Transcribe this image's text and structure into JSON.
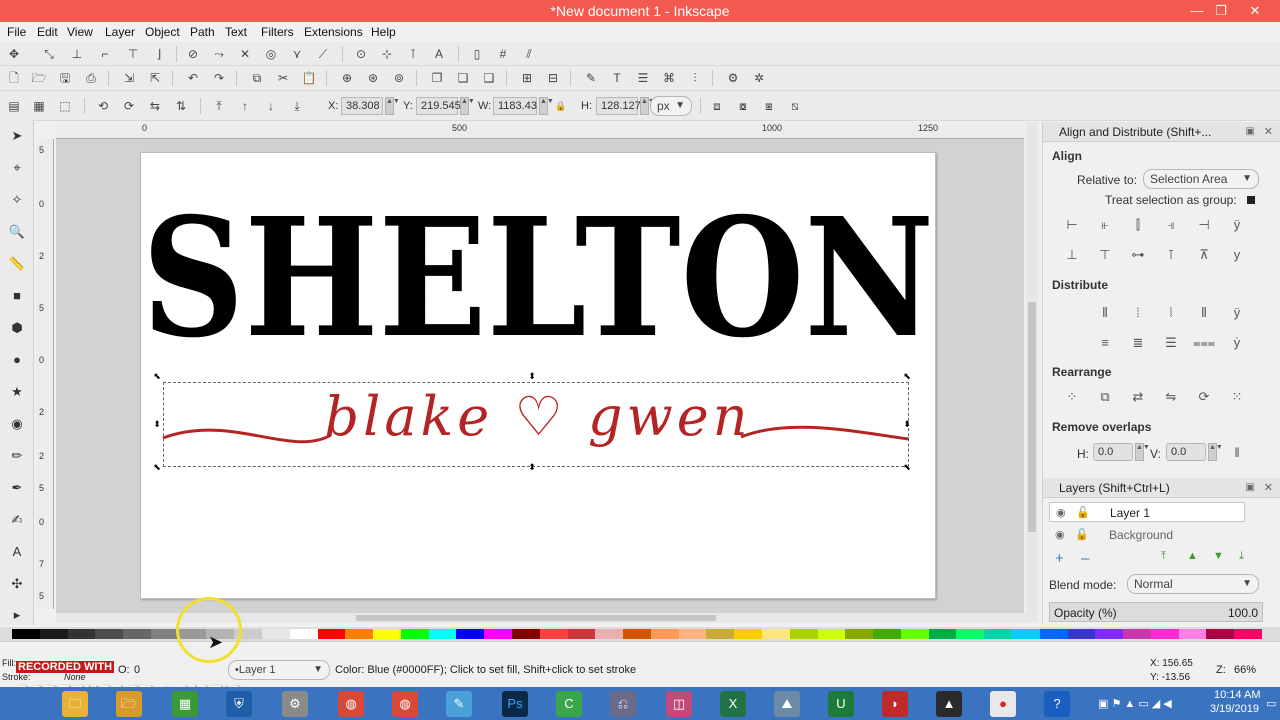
{
  "window": {
    "title": "*New document 1 - Inkscape",
    "minimize": "—",
    "restore": "❐",
    "close": "✕"
  },
  "menu": [
    "File",
    "Edit",
    "View",
    "Layer",
    "Object",
    "Path",
    "Text",
    "Filters",
    "Extensions",
    "Help"
  ],
  "selector_bar": {
    "x_label": "X:",
    "x_value": "38.308",
    "y_label": "Y:",
    "y_value": "219.545",
    "w_label": "W:",
    "w_value": "1183.43",
    "h_label": "H:",
    "h_value": "128.127",
    "unit": "px"
  },
  "ruler": {
    "ticks": [
      "0",
      "500",
      "1000",
      "1250"
    ],
    "vticks": [
      "5",
      "0",
      "2",
      "5",
      "0",
      "2",
      "2",
      "5",
      "0",
      "7",
      "5"
    ]
  },
  "canvas": {
    "heading": "SHELTON",
    "script": "blake ♡ gwen",
    "script_color": "#b52424"
  },
  "icons": {
    "spin": "▲▼",
    "lock": "🔒",
    "handle_corner": "⬉",
    "handle_side": "⬍"
  },
  "align_panel": {
    "title": "Align and Distribute (Shift+...",
    "align_label": "Align",
    "relative_label": "Relative to:",
    "relative_value": "Selection Area",
    "treat_label": "Treat selection as group:",
    "distribute_label": "Distribute",
    "rearrange_label": "Rearrange",
    "remove_overlaps_label": "Remove overlaps",
    "h_label": "H:",
    "h_value": "0.0",
    "v_label": "V:",
    "v_value": "0.0"
  },
  "layers_panel": {
    "title": "Layers (Shift+Ctrl+L)",
    "layers": [
      "Layer 1",
      "Background"
    ],
    "blend_label": "Blend mode:",
    "blend_value": "Normal",
    "opacity_label": "Opacity (%)",
    "opacity_value": "100.0"
  },
  "status": {
    "fill_label": "Fill:",
    "stroke_label": "Stroke:",
    "stroke_value": "None",
    "opacity_label": "O:",
    "opacity_value": "0",
    "layer_value": "•Layer 1",
    "message": "Color: Blue (#0000FF); Click to set fill, Shift+click to set stroke",
    "coord_x": "X: 156.65",
    "coord_y": "Y: -13.56",
    "zoom_label": "Z:",
    "zoom_value": "66%"
  },
  "overlay": {
    "recorded": "RECORDED WITH",
    "screencast": "SCREENCAST ◉ MATIC"
  },
  "taskbar": {
    "time": "10:14 AM",
    "date": "3/19/2019",
    "ps_label": "Ps"
  },
  "palette": [
    "#000000",
    "#1a1a1a",
    "#333333",
    "#4d4d4d",
    "#666666",
    "#808080",
    "#999999",
    "#b3b3b3",
    "#cccccc",
    "#e6e6e6",
    "#ffffff",
    "#ff0000",
    "#ff8000",
    "#ffff00",
    "#00ff00",
    "#00ffff",
    "#0000ff",
    "#ff00ff",
    "#800000",
    "#ff4040",
    "#c83737",
    "#e9afaf",
    "#d45500",
    "#ff9955",
    "#ffb380",
    "#c8ab37",
    "#ffcc00",
    "#ffe680",
    "#aad400",
    "#ccff00",
    "#88aa00",
    "#44aa00",
    "#66ff00",
    "#00aa44",
    "#00ff66",
    "#00d4aa",
    "#00ccff",
    "#0066ff",
    "#3737c8",
    "#7f2aff",
    "#c837ab",
    "#ff2ad4",
    "#ff80e5",
    "#aa0044",
    "#ff0066"
  ]
}
